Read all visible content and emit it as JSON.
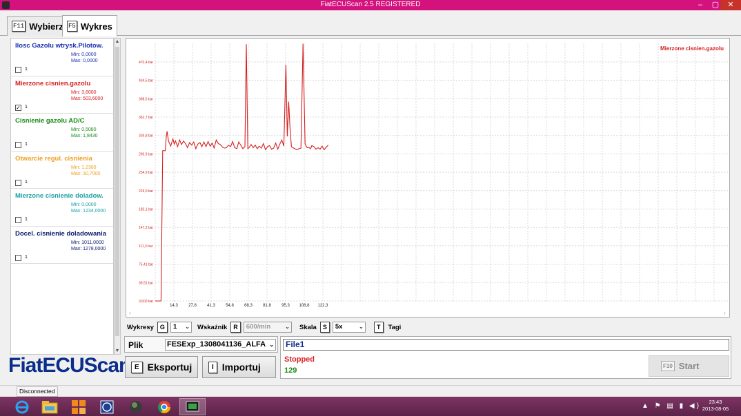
{
  "window": {
    "title": "FiatECUScan 2.5 REGISTERED",
    "controls": {
      "minimize": "–",
      "maximize": "▢",
      "close": "✕"
    }
  },
  "tabs": [
    {
      "key": "F11",
      "label": "Wybierz",
      "active": false
    },
    {
      "key": "F5",
      "label": "Wykres",
      "active": true
    }
  ],
  "parameters": [
    {
      "name": "Ilosc Gazolu wtrysk.Pilotow.",
      "min": "Min: 0,0000",
      "max": "Max: 0,0000",
      "checked": false,
      "count": "1",
      "color": "#1a2fb0"
    },
    {
      "name": "Mierzone cisnien.gazolu",
      "min": "Min: 3,6000",
      "max": "Max: 503,6000",
      "checked": true,
      "count": "1",
      "color": "#d42020"
    },
    {
      "name": "Cisnienie gazolu AD/C",
      "min": "Min: 0,5080",
      "max": "Max: 1,8430",
      "checked": false,
      "count": "1",
      "color": "#1a8c1a"
    },
    {
      "name": "Otwarcie regul. cisnienia",
      "min": "Min: 1,2300",
      "max": "Max: 30,7000",
      "checked": false,
      "count": "1",
      "color": "#f0a020"
    },
    {
      "name": "Mierzone cisnienie doladow.",
      "min": "Min: 0,0000",
      "max": "Max: 1234,0000",
      "checked": false,
      "count": "1",
      "color": "#1aa0a0"
    },
    {
      "name": "Docel. cisnienie doladowania",
      "min": "Min: 1011,0000",
      "max": "Max: 1278,0000",
      "checked": false,
      "count": "1",
      "color": "#0b1a6c"
    }
  ],
  "logo": "FiatECUScan",
  "chart_data": {
    "type": "line",
    "legend": "Mierzone cisnien.gazolu",
    "series_color": "#d42020",
    "ylabel": "",
    "xlabel": "",
    "y_ticks": [
      "3,600 bar",
      "39,51 bar",
      "75,41 bar",
      "111,3 bar",
      "147,2 bar",
      "183,1 bar",
      "219,0 bar",
      "254,9 bar",
      "290,9 bar",
      "326,8 bar",
      "362,7 bar",
      "398,6 bar",
      "434,5 bar",
      "470,4 bar"
    ],
    "x_ticks": [
      "14,3",
      "27,8",
      "41,3",
      "54,8",
      "68,3",
      "81,8",
      "95,3",
      "108,8",
      "122,3"
    ],
    "ylim": [
      3.6,
      506.3
    ],
    "grid": true,
    "series": [
      {
        "name": "Mierzone cisnien.gazolu",
        "x": [
          0.8,
          5.0,
          6.2,
          8.1,
          8.8,
          9.4,
          10.4,
          12.0,
          13.6,
          14.6,
          15.5,
          17.0,
          18.5,
          19.8,
          21.3,
          22.7,
          24.2,
          25.7,
          27.2,
          28.7,
          30.2,
          31.7,
          33.2,
          34.6,
          36.1,
          37.6,
          39.1,
          40.6,
          42.1,
          43.5,
          45.0,
          46.5,
          48.0,
          49.5,
          51.0,
          52.4,
          53.9,
          55.4,
          56.9,
          58.4,
          59.9,
          61.3,
          62.8,
          64.3,
          65.8,
          66.8,
          67.9,
          68.8,
          70.3,
          71.8,
          73.3,
          74.7,
          76.2,
          77.7,
          79.2,
          80.7,
          82.2,
          83.6,
          85.1,
          86.6,
          88.1,
          89.6,
          91.1,
          92.5,
          94.0,
          95.5,
          96.5,
          97.5,
          98.5,
          99.5,
          100.5,
          102.0,
          103.5,
          104.9,
          106.4,
          107.9,
          109.4,
          110.9,
          112.4,
          113.4,
          114.3,
          115.8,
          117.3,
          118.8,
          120.3,
          121.7,
          123.2,
          124.7,
          126.2
        ],
        "y": [
          3.6,
          3.6,
          297,
          297,
          325,
          335,
          316,
          306,
          320,
          310,
          316,
          305,
          318,
          309,
          316,
          311,
          303,
          313,
          308,
          314,
          301,
          310,
          313,
          305,
          314,
          305,
          315,
          306,
          312,
          302,
          318,
          311,
          309,
          304,
          302,
          303,
          308,
          305,
          315,
          303,
          301,
          314,
          308,
          301,
          305,
          505,
          301,
          303,
          309,
          303,
          308,
          301,
          306,
          302,
          311,
          299,
          305,
          307,
          300,
          302,
          312,
          300,
          310,
          318,
          306,
          465,
          325,
          393,
          340,
          305,
          303,
          301,
          299,
          301,
          302,
          506,
          310,
          303,
          303,
          301,
          307,
          305,
          300,
          303,
          300,
          306,
          299,
          304,
          308
        ]
      }
    ]
  },
  "controls": {
    "wykresy": {
      "label": "Wykresy",
      "key": "G",
      "value": "1"
    },
    "wskaznik": {
      "label": "Wskaźnik",
      "key": "R",
      "value": "600/min"
    },
    "skala": {
      "label": "Skala",
      "key": "S",
      "value": "5x"
    },
    "tagi": {
      "label": "Tagi",
      "key": "T"
    }
  },
  "file": {
    "label": "Plik",
    "value": "FESExp_1308041136_ALFA"
  },
  "buttons": {
    "eksportuj": {
      "key": "E",
      "label": "Eksportuj"
    },
    "importuj": {
      "key": "I",
      "label": "Importuj"
    },
    "start": {
      "key": "F10",
      "label": "Start"
    }
  },
  "session": {
    "name": "File1",
    "status": "Stopped",
    "count": "129"
  },
  "statusbar": {
    "connection": "Disconnected"
  },
  "taskbar": {
    "items": [
      "ie-icon",
      "explorer-icon",
      "metro-icon",
      "help-icon",
      "globe-icon",
      "chrome-icon",
      "fiatecuscan-icon"
    ],
    "tray": "▲ ⚑ ▤ ▮ ◀)",
    "time": "23:43",
    "date": "2013-08-05"
  }
}
